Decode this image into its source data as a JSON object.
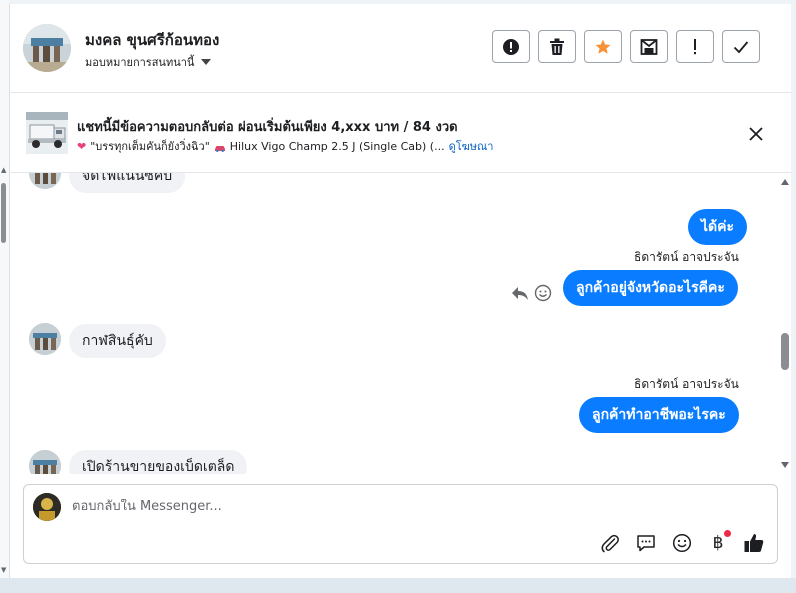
{
  "header": {
    "contact_name": "มงคล ขุนศรีก้อนทอง",
    "assign_label": "มอบหมายการสนทนานี้"
  },
  "actions": [
    {
      "icon": "alert-circle-icon"
    },
    {
      "icon": "trash-icon"
    },
    {
      "icon": "star-icon",
      "color": "#f7923a"
    },
    {
      "icon": "mark-unread-icon"
    },
    {
      "icon": "exclamation-icon"
    },
    {
      "icon": "checkmark-icon"
    }
  ],
  "ad": {
    "title": "แชทนี้มีข้อความตอบกลับต่อ ผ่อนเริ่มต้นเพียง 4,xxx บาท / 84 งวด",
    "subtitle": "\"บรรทุกเต็มคันก็ยังวิ่งฉิว\"",
    "car_model": "Hilux Vigo Champ 2.5 J (Single Cab) (...",
    "link": "ดูโฆษณา"
  },
  "messages": {
    "partial_top": "จัดไฟแนนซ์คับ",
    "out1": "ได้ค่ะ",
    "sender1": "ธิดารัตน์ อาจประจัน",
    "out2": "ลูกค้าอยู่จังหวัดอะไรคีคะ",
    "in1": "กาฬสินธุ์คับ",
    "sender2": "ธิดารัตน์ อาจประจัน",
    "out3": "ลูกค้าทำอาชีพอะไรคะ",
    "in2": "เปิดร้านขายของเบ็ดเตล็ด"
  },
  "composer": {
    "placeholder": "ตอบกลับใน Messenger...",
    "tools": [
      "paperclip-icon",
      "quick-reply-icon",
      "emoji-icon",
      "baht-icon",
      "thumbs-up-icon"
    ]
  },
  "colors": {
    "accent": "#0a7cff",
    "incoming_bubble": "#f0f2f5",
    "star": "#f7923a",
    "notification_dot": "#f02849"
  }
}
